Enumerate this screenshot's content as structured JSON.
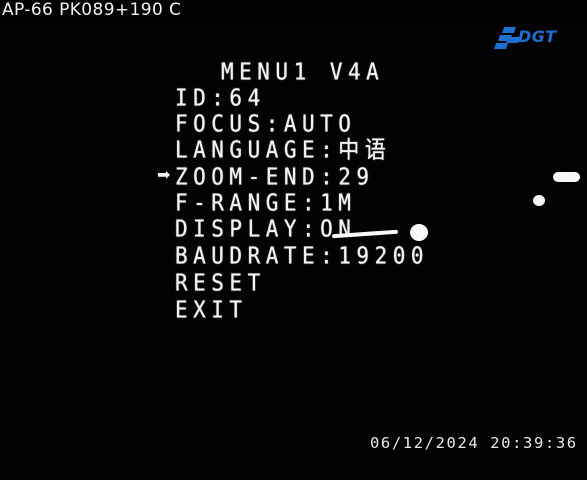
{
  "header": {
    "camera_id": "AP-66 PK089+190 C",
    "logo_text": "DGT"
  },
  "menu": {
    "title": "MENU1 V4A",
    "items": [
      {
        "label": "ID:64"
      },
      {
        "label": "FOCUS:AUTO"
      },
      {
        "label": "LANGUAGE:中语"
      },
      {
        "label": "ZOOM-END:29",
        "selected": true
      },
      {
        "label": "F-RANGE:1M"
      },
      {
        "label": "DISPLAY:ON"
      },
      {
        "label": "BAUDRATE:19200"
      },
      {
        "label": "RESET"
      },
      {
        "label": "EXIT"
      }
    ],
    "cursor_icon": "arrow-right-icon"
  },
  "overlay": {
    "timestamp": "06/12/2024 20:39:36"
  },
  "colors": {
    "background": "#020202",
    "osd_text": "#f3f3f3",
    "logo_blue": "#1e6fd0"
  }
}
